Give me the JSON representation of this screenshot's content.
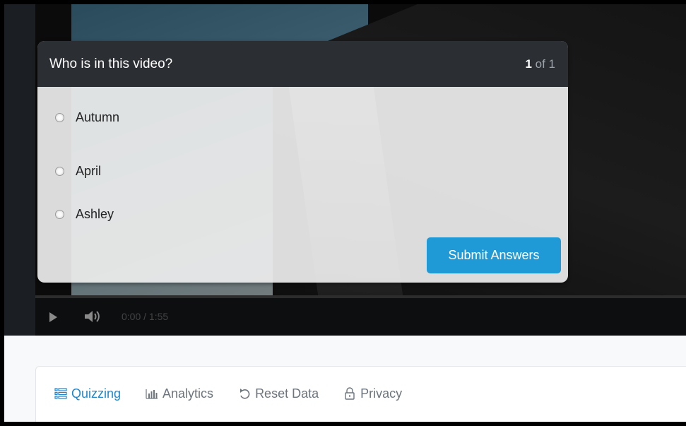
{
  "video": {
    "time_display": "0:00 / 1:55"
  },
  "quiz": {
    "title": "Who is in this video?",
    "counter_current": "1",
    "counter_rest": " of 1",
    "options": [
      "Autumn",
      "April",
      "Ashley"
    ],
    "submit_label": "Submit Answers"
  },
  "tabs": [
    {
      "label": "Quizzing",
      "icon": "list-icon"
    },
    {
      "label": "Analytics",
      "icon": "bar-chart-icon"
    },
    {
      "label": "Reset Data",
      "icon": "undo-icon"
    },
    {
      "label": "Privacy",
      "icon": "lock-icon"
    }
  ],
  "colors": {
    "accent": "#1f9ad6",
    "tab_active": "#1f87cf",
    "header_bg": "#2b2e33"
  }
}
